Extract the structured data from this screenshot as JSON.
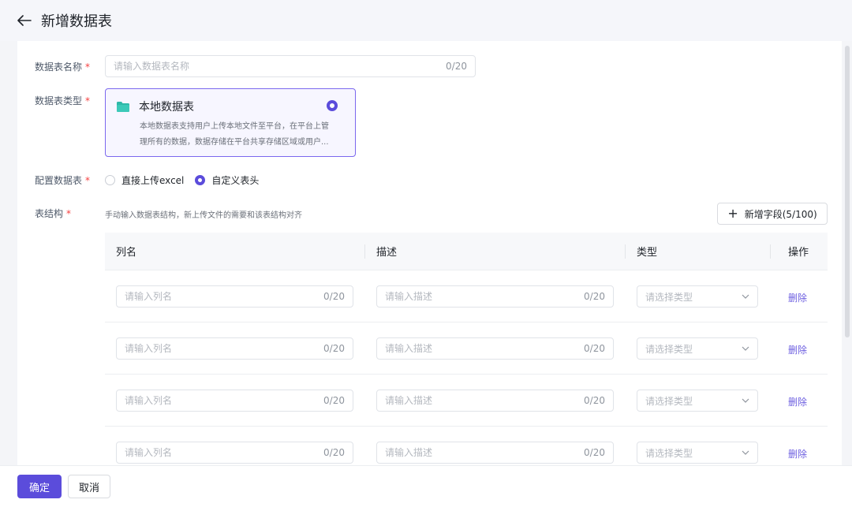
{
  "header": {
    "title": "新增数据表",
    "back_icon": "arrow-left-icon"
  },
  "form": {
    "name": {
      "label": "数据表名称",
      "placeholder": "请输入数据表名称",
      "counter": "0/20",
      "required_mark": "*"
    },
    "type": {
      "label": "数据表类型",
      "required_mark": "*",
      "option": {
        "title": "本地数据表",
        "icon": "folder-icon",
        "desc_line1": "本地数据表支持用户上传本地文件至平台，在平台上管",
        "desc_line2": "理所有的数据，数据存储在平台共享存储区域或用户...",
        "selected": true
      }
    },
    "config": {
      "label": "配置数据表",
      "required_mark": "*",
      "options": [
        {
          "label": "直接上传excel",
          "selected": false
        },
        {
          "label": "自定义表头",
          "selected": true
        }
      ]
    },
    "structure": {
      "label": "表结构",
      "required_mark": "*",
      "hint": "手动输入数据表结构，新上传文件的需要和该表结构对齐",
      "add_button": "新增字段(5/100)"
    }
  },
  "table": {
    "columns": [
      "列名",
      "描述",
      "类型",
      "操作"
    ],
    "rows": [
      {
        "name_placeholder": "请输入列名",
        "name_counter": "0/20",
        "desc_placeholder": "请输入描述",
        "desc_counter": "0/20",
        "type_placeholder": "请选择类型",
        "action": "删除"
      },
      {
        "name_placeholder": "请输入列名",
        "name_counter": "0/20",
        "desc_placeholder": "请输入描述",
        "desc_counter": "0/20",
        "type_placeholder": "请选择类型",
        "action": "删除"
      },
      {
        "name_placeholder": "请输入列名",
        "name_counter": "0/20",
        "desc_placeholder": "请输入描述",
        "desc_counter": "0/20",
        "type_placeholder": "请选择类型",
        "action": "删除"
      },
      {
        "name_placeholder": "请输入列名",
        "name_counter": "0/20",
        "desc_placeholder": "请输入描述",
        "desc_counter": "0/20",
        "type_placeholder": "请选择类型",
        "action": "删除"
      }
    ]
  },
  "footer": {
    "confirm": "确定",
    "cancel": "取消"
  },
  "colors": {
    "accent": "#5b4cdb",
    "required": "#f53f3f",
    "link": "#6d5fe0"
  }
}
